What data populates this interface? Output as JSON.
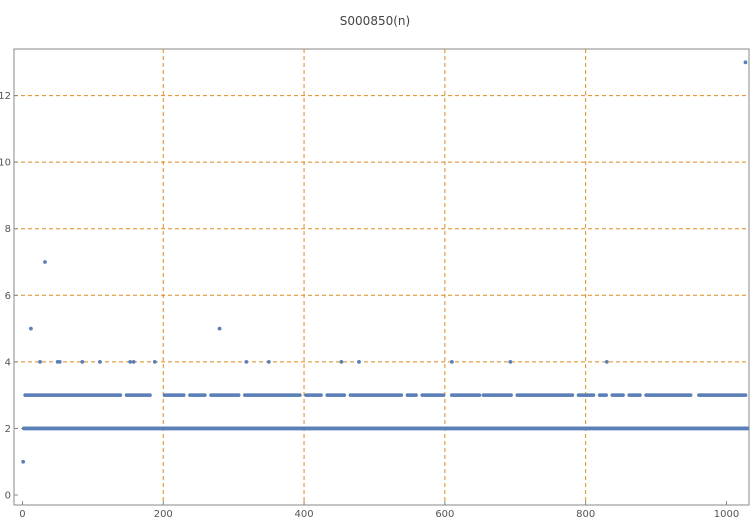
{
  "chart_data": {
    "type": "scatter",
    "title": "S000850(n)",
    "xlabel": "",
    "ylabel": "",
    "xlim": [
      -12,
      1032
    ],
    "ylim": [
      -0.3,
      13.4
    ],
    "x_ticks": [
      0,
      200,
      400,
      600,
      800,
      1000
    ],
    "y_ticks": [
      0,
      2,
      4,
      6,
      8,
      10,
      12
    ],
    "grid": true,
    "colors": {
      "points": "#5b7fb7",
      "grid": "#e08a1e",
      "frame": "#888888"
    },
    "series": [
      {
        "values_note_absent": "",
        "points": [
          [
            1,
            1
          ],
          [
            12,
            5
          ],
          [
            32,
            7
          ],
          [
            280,
            5
          ],
          [
            1027,
            13
          ],
          [
            25,
            4
          ],
          [
            50,
            4
          ],
          [
            53,
            4
          ],
          [
            85,
            4
          ],
          [
            110,
            4
          ],
          [
            153,
            4
          ],
          [
            158,
            4
          ],
          [
            188,
            4
          ],
          [
            318,
            4
          ],
          [
            350,
            4
          ],
          [
            453,
            4
          ],
          [
            478,
            4
          ],
          [
            610,
            4
          ],
          [
            693,
            4
          ],
          [
            830,
            4
          ]
        ],
        "level_2_range": [
          2,
          1030
        ],
        "level_3_range": [
          4,
          1028
        ],
        "level_3_gaps": [
          [
            140,
            146
          ],
          [
            183,
            199
          ],
          [
            232,
            236
          ],
          [
            262,
            267
          ],
          [
            309,
            313
          ],
          [
            396,
            402
          ],
          [
            425,
            430
          ],
          [
            458,
            463
          ],
          [
            541,
            545
          ],
          [
            562,
            566
          ],
          [
            601,
            608
          ],
          [
            650,
            654
          ],
          [
            697,
            702
          ],
          [
            784,
            787
          ],
          [
            813,
            818
          ],
          [
            831,
            836
          ],
          [
            855,
            860
          ],
          [
            879,
            885
          ],
          [
            952,
            958
          ]
        ]
      }
    ]
  }
}
